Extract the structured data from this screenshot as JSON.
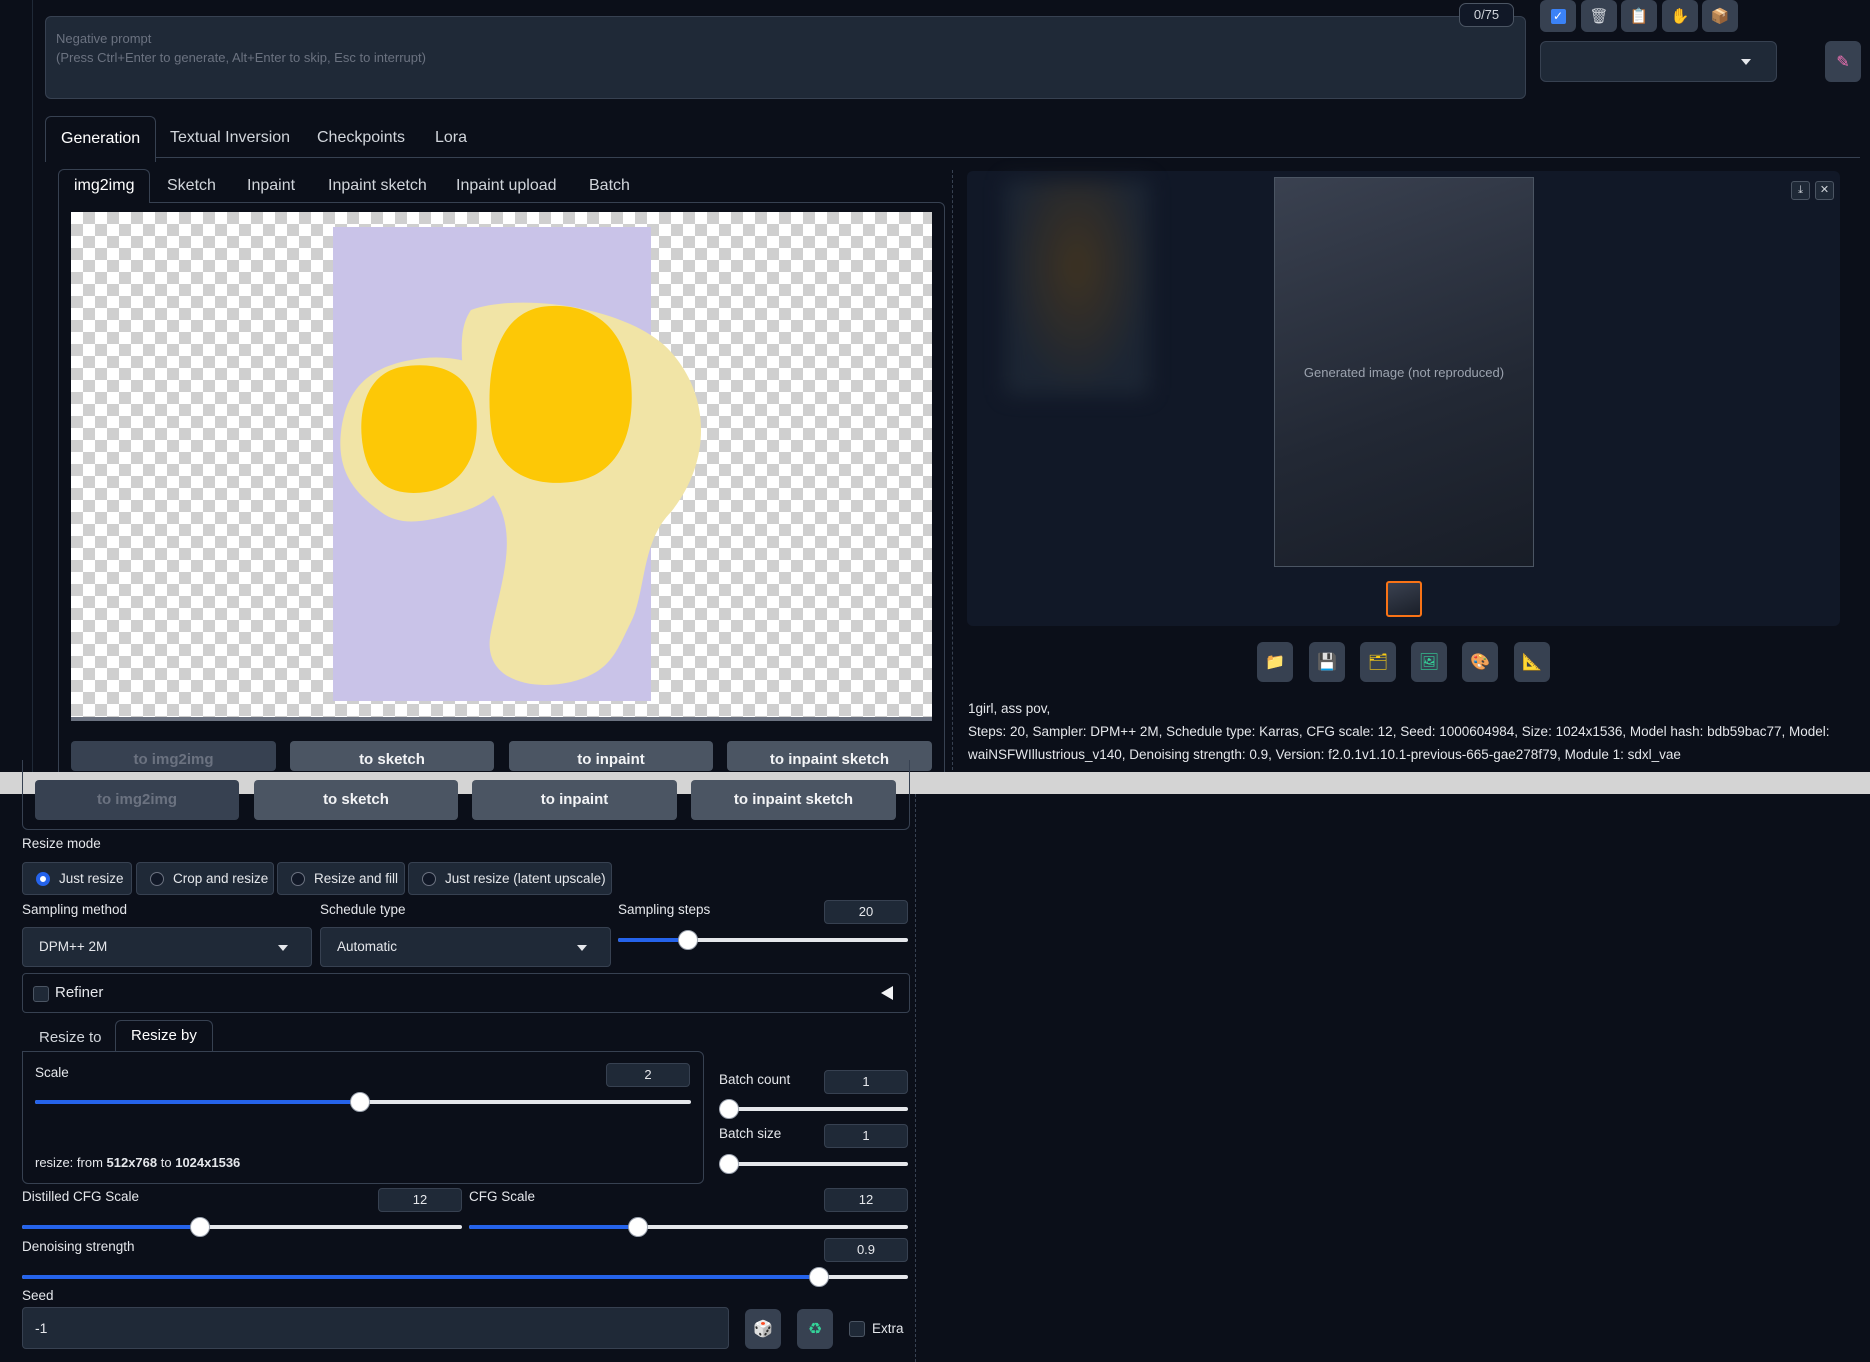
{
  "negative_prompt": {
    "placeholder_title": "Negative prompt",
    "placeholder_hint": "(Press Ctrl+Enter to generate, Alt+Enter to skip, Esc to interrupt)",
    "token_count": "0/75"
  },
  "toolbar_icons": [
    "checkbox-icon",
    "trash-icon",
    "clipboard-icon",
    "hand-icon",
    "package-icon"
  ],
  "main_tabs": [
    "Generation",
    "Textual Inversion",
    "Checkpoints",
    "Lora"
  ],
  "sub_tabs": [
    "img2img",
    "Sketch",
    "Inpaint",
    "Inpaint sketch",
    "Inpaint upload",
    "Batch"
  ],
  "send_to": [
    "to img2img",
    "to sketch",
    "to inpaint",
    "to inpaint sketch"
  ],
  "output": {
    "image_placeholder": "Generated image (not reproduced)",
    "info_prompt": "1girl, ass pov,",
    "info_params": "Steps: 20, Sampler: DPM++ 2M, Schedule type: Karras, CFG scale: 12, Seed: 1000604984, Size: 1024x1536, Model hash: bdb59bac77, Model: waiNSFWIllustrious_v140, Denoising strength: 0.9, Version: f2.0.1v1.10.1-previous-665-gae278f79, Module 1: sdxl_vae",
    "button_icons": [
      "folder-icon",
      "save-icon",
      "zip-icon",
      "image-icon",
      "palette-icon",
      "ruler-icon"
    ]
  },
  "resize_mode": {
    "label": "Resize mode",
    "options": [
      "Just resize",
      "Crop and resize",
      "Resize and fill",
      "Just resize (latent upscale)"
    ],
    "selected": "Just resize"
  },
  "sampling": {
    "method_label": "Sampling method",
    "method_value": "DPM++ 2M",
    "schedule_label": "Schedule type",
    "schedule_value": "Automatic",
    "steps_label": "Sampling steps",
    "steps_value": "20",
    "steps_fraction": 0.24
  },
  "refiner": {
    "label": "Refiner"
  },
  "resize_tabs": [
    "Resize to",
    "Resize by"
  ],
  "scale": {
    "label": "Scale",
    "value": "2",
    "fraction": 0.495,
    "info_prefix": "resize: from ",
    "from": "512x768",
    "to_word": " to ",
    "to": "1024x1536"
  },
  "batch": {
    "count_label": "Batch count",
    "count_value": "1",
    "size_label": "Batch size",
    "size_value": "1"
  },
  "distilled_cfg": {
    "label": "Distilled CFG Scale",
    "value": "12",
    "fraction": 0.405
  },
  "cfg": {
    "label": "CFG Scale",
    "value": "12",
    "fraction": 0.385
  },
  "denoise": {
    "label": "Denoising strength",
    "value": "0.9",
    "fraction": 0.9
  },
  "seed": {
    "label": "Seed",
    "value": "-1",
    "extra_label": "Extra"
  },
  "colors": {
    "background": "#0b0f19",
    "accent": "#2563eb",
    "sketch_bg": "#c9c3e8",
    "sketch_cream": "#f1e4a6",
    "sketch_yellow": "#fdc806"
  }
}
